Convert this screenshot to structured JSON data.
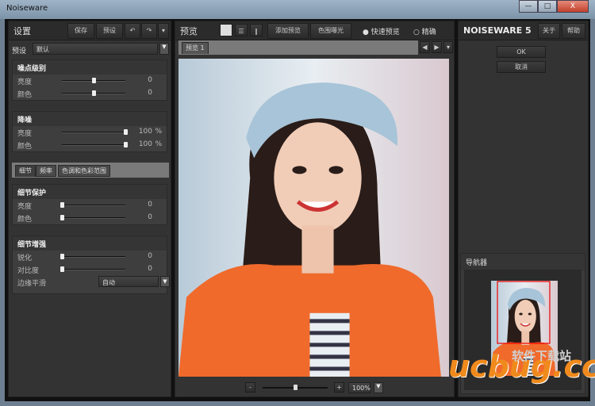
{
  "window": {
    "title": "Noiseware",
    "minimize": "—",
    "maximize": "□",
    "close": "X"
  },
  "settings": {
    "title": "设置",
    "save": "保存",
    "presets": "预设",
    "undo": "↶",
    "redo": "↷",
    "more": "▾",
    "preset_label": "预设",
    "preset_value": "默认",
    "noise_level": {
      "title": "噪点级别",
      "rows": [
        {
          "label": "亮度",
          "value": "0",
          "level": 0.5
        },
        {
          "label": "颜色",
          "value": "0",
          "level": 0.5
        }
      ]
    },
    "noise_reduction": {
      "title": "降噪",
      "rows": [
        {
          "label": "亮度",
          "value": "100",
          "unit": "%",
          "level": 1.0
        },
        {
          "label": "颜色",
          "value": "100",
          "unit": "%",
          "level": 1.0
        }
      ]
    },
    "tabs": [
      {
        "label": "细节",
        "active": true
      },
      {
        "label": "频率"
      },
      {
        "label": "色调和色彩范围"
      }
    ],
    "detail_protection": {
      "title": "细节保护",
      "rows": [
        {
          "label": "亮度",
          "value": "0",
          "level": 0
        },
        {
          "label": "颜色",
          "value": "0",
          "level": 0
        }
      ]
    },
    "detail_enhance": {
      "title": "细节增强",
      "rows": [
        {
          "label": "锐化",
          "value": "0",
          "level": 0
        },
        {
          "label": "对比度",
          "value": "0",
          "level": 0
        }
      ],
      "edge_label": "边缘平滑",
      "edge_value": "自动"
    }
  },
  "preview": {
    "title": "预览",
    "add_preview": "添加预览",
    "gamut": "色围曝光",
    "fast_preview": "快速预览",
    "accurate": "精确",
    "tab": "预览 1",
    "zoom_minus": "-",
    "zoom_plus": "+",
    "zoom_value": "100%",
    "zoom_level": 0.5
  },
  "right": {
    "brand": "NOISEWARE 5",
    "about": "关于",
    "help": "帮助",
    "ok": "OK",
    "cancel": "取消",
    "navigator": "导航器"
  },
  "watermark": {
    "text": "ucbug.cc",
    "subtext": "软件下载站"
  }
}
